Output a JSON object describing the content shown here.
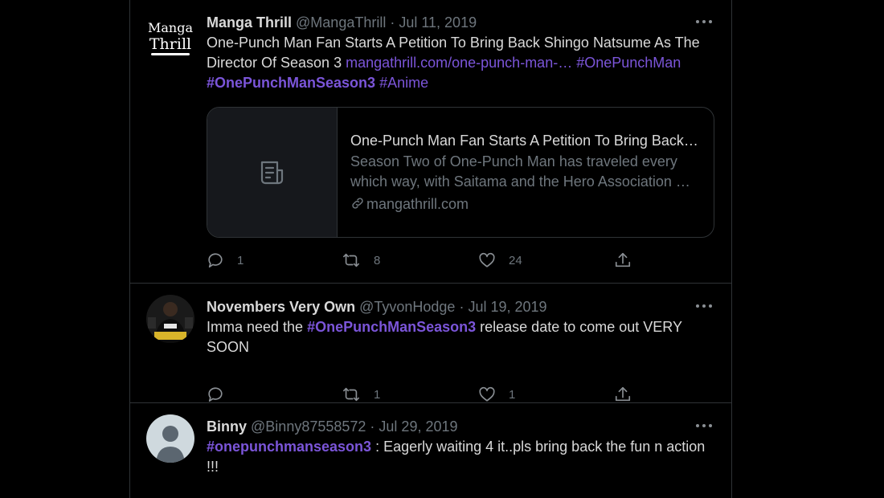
{
  "tweets": [
    {
      "name": "Manga Thrill",
      "handle": "@MangaThrill",
      "sep": " · ",
      "date": "Jul 11, 2019",
      "avatar": {
        "logo_line1": "Manga",
        "logo_line2": "Thrill"
      },
      "text_plain": "One-Punch Man Fan Starts A Petition To Bring Back Shingo Natsume As The Director Of Season 3 ",
      "link": "mangathrill.com/one-punch-man-…",
      "hashtag1": "#OnePunchMan",
      "hashtag2": "#OnePunchManSeason3",
      "hashtag3": "#Anime",
      "card": {
        "title": "One-Punch Man Fan Starts A Petition To Bring Back…",
        "description": "Season Two of One-Punch Man has traveled every which way, with Saitama and the Hero Association …",
        "domain": "mangathrill.com",
        "thumb_icon": "document-icon"
      },
      "replies": "1",
      "retweets": "8",
      "likes": "24"
    },
    {
      "name": "Novembers Very Own",
      "handle": "@TyvonHodge",
      "sep": " · ",
      "date": "Jul 19, 2019",
      "text_before": "Imma need the ",
      "hashtag": "#OnePunchManSeason3",
      "text_after": " release date to come out VERY SOON",
      "replies": "",
      "retweets": "1",
      "likes": "1"
    },
    {
      "name": "Binny",
      "handle": "@Binny87558572",
      "sep": " · ",
      "date": "Jul 29, 2019",
      "hashtag": "#onepunchmanseason3",
      "text_after": " : Eagerly waiting 4 it..pls bring back the fun n action !!!"
    }
  ],
  "colors": {
    "background": "#000000",
    "link": "#7b55d9",
    "muted": "#6e767d",
    "border": "#2f3336"
  }
}
